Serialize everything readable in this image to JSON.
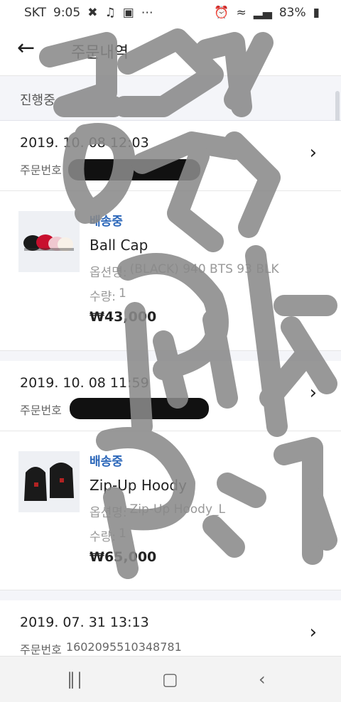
{
  "status_bar": {
    "carrier": "SKT",
    "time": "9:05",
    "battery": "83%"
  },
  "header": {
    "title": "주문내역"
  },
  "section": {
    "label": "진행중"
  },
  "orders": [
    {
      "date": "2019. 10. 08 12:03",
      "order_no_label": "주문번호",
      "order_no_value": "",
      "item": {
        "status": "배송중",
        "name": "Ball Cap",
        "option_label": "옵션명:",
        "option_value": "(BLACK) 940 BTS 93 BLK",
        "qty_label": "수량:",
        "qty_value": "1",
        "price": "₩43,000"
      }
    },
    {
      "date": "2019. 10. 08 11:59",
      "order_no_label": "주문번호",
      "order_no_value": "",
      "item": {
        "status": "배송중",
        "name": "Zip-Up Hoody",
        "option_label": "옵션명:",
        "option_value": "Zip-Up Hoody_L",
        "qty_label": "수량:",
        "qty_value": "1",
        "price": "₩65,000"
      }
    },
    {
      "date": "2019. 07. 31 13:13",
      "order_no_label": "주문번호",
      "order_no_value": "1602095510348781"
    }
  ],
  "icons": {
    "back": "back-arrow-icon",
    "chevron": "chevron-right-icon",
    "nav_recent": "recent-apps-icon",
    "nav_home": "home-icon",
    "nav_back": "nav-back-icon"
  },
  "colors": {
    "status_blue": "#2a66b9",
    "section_bg": "#f4f5f9",
    "scribble": "#8a8a8a"
  }
}
